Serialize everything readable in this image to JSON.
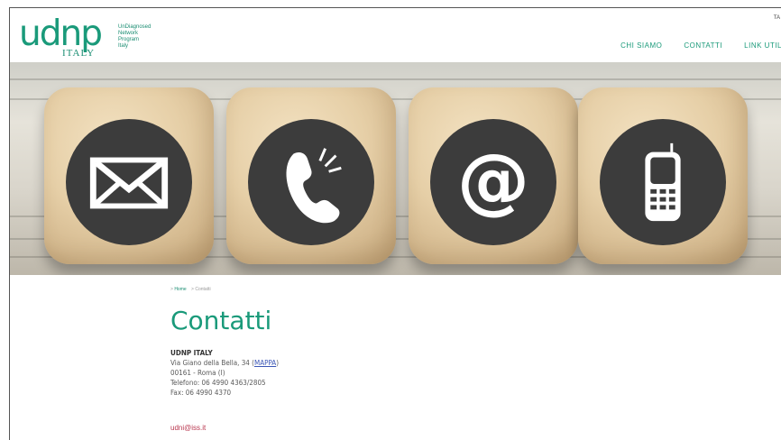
{
  "header": {
    "logo_mark": "udnp",
    "logo_sub": "ITALY",
    "logo_tag": [
      "UnDiagnosed",
      "Network",
      "Program",
      "Italy"
    ],
    "lang": "TA",
    "nav": [
      "CHI SIAMO",
      "CONTATTI",
      "LINK UTIL"
    ]
  },
  "breadcrumb": {
    "home": "Home",
    "separator": ">",
    "current": "Contatti"
  },
  "page_title": "Contatti",
  "contact": {
    "org": "UDNP ITALY",
    "address": "Via Giano della Bella, 34",
    "map_link": "MAPPA",
    "city": "00161 - Roma (I)",
    "phone": "Telefono: 06 4990 4363/2805",
    "fax": "Fax: 06 4990 4370",
    "email": "udni@iss.it"
  },
  "hero_icons": [
    "envelope-icon",
    "phone-icon",
    "at-sign-icon",
    "mobile-phone-icon"
  ],
  "colors": {
    "brand": "#1a9a7a",
    "link": "#3a55b5",
    "email": "#b9374f",
    "icon_circle": "#3c3c3c"
  }
}
